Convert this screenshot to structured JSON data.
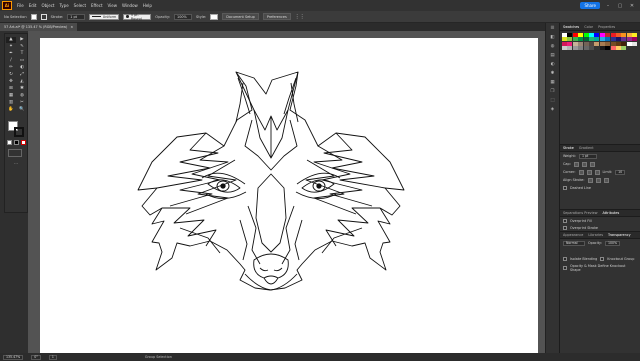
{
  "menubar": {
    "logo": "Ai",
    "items": [
      "File",
      "Edit",
      "Object",
      "Type",
      "Select",
      "Effect",
      "View",
      "Window",
      "Help"
    ],
    "share_label": "Share",
    "win_controls": [
      "–",
      "▢",
      "✕"
    ]
  },
  "controlbar": {
    "selection_label": "No Selection",
    "stroke_label": "Stroke:",
    "stroke_weight": "1 pt",
    "stroke_profile": "Uniform",
    "brush": "5 pt. Round",
    "opacity_label": "Opacity:",
    "opacity_value": "100%",
    "style_label": "Style:",
    "document_setup": "Document Setup",
    "preferences": "Preferences"
  },
  "document_tab": {
    "title": "57 Art.ai* @ 135.47 % (RGB/Preview)",
    "close": "×"
  },
  "tools": [
    "▲",
    "▶",
    "✦",
    "✎",
    "✒",
    "T",
    "/",
    "▭",
    "✏",
    "◐",
    "↻",
    "⤢",
    "✥",
    "◭",
    "⊞",
    "✱",
    "▦",
    "◍",
    "▥",
    "✂",
    "✋",
    "🔍"
  ],
  "toolbar_more": "···",
  "status": {
    "zoom": "135.47%",
    "angle": "0°",
    "artboard_num": "1",
    "tool_name": "Group Selection"
  },
  "side_icons": [
    "☰",
    "◧",
    "◍",
    "▤",
    "◐",
    "✱",
    "▦",
    "❐",
    "⬚",
    "◈"
  ],
  "swatches_panel": {
    "tabs": [
      "Swatches",
      "Color",
      "Properties"
    ],
    "colors": [
      "#ffffff",
      "#000000",
      "#ff0000",
      "#ffff00",
      "#00ff00",
      "#00ffff",
      "#0000ff",
      "#ff00ff",
      "#c1272d",
      "#ed1c24",
      "#f15a24",
      "#f7931e",
      "#fbb03b",
      "#fcee21",
      "#d9e021",
      "#8cc63f",
      "#39b54a",
      "#009245",
      "#006837",
      "#22b573",
      "#00a99d",
      "#29abe2",
      "#0071bc",
      "#2e3192",
      "#1b1464",
      "#662d91",
      "#93278f",
      "#9e005d",
      "#d4145a",
      "#ed1e79",
      "#c7b299",
      "#998675",
      "#736357",
      "#534741",
      "#c69c6d",
      "#a67c52",
      "#8c6239",
      "#754c24",
      "#603813",
      "#42210b",
      "#ffffff",
      "#e6e6e6",
      "#cccccc",
      "#b3b3b3",
      "#999999",
      "#808080",
      "#666666",
      "#4d4d4d",
      "#333333",
      "#1a1a1a",
      "#000000",
      "#ff6666",
      "#ffcc66",
      "#99cc66"
    ]
  },
  "stroke_panel": {
    "tabs": [
      "Stroke",
      "Gradient"
    ],
    "weight_label": "Weight:",
    "weight_value": "1 pt",
    "cap_label": "Cap:",
    "corner_label": "Corner:",
    "limit_label": "Limit:",
    "limit_value": "10",
    "align_label": "Align Stroke:",
    "dashed_label": "Dashed Line"
  },
  "attributes_panel": {
    "tabs": [
      "Separations Preview",
      "Attributes"
    ],
    "overprint_fill": "Overprint Fill",
    "overprint_stroke": "Overprint Stroke"
  },
  "transparency_panel": {
    "tabs": [
      "Appearance",
      "Libraries",
      "Transparency"
    ],
    "blend_mode": "Normal",
    "opacity_label": "Opacity:",
    "opacity_value": "100%",
    "isolate": "Isolate Blending",
    "knockout": "Knockout Group",
    "opacity_mask": "Opacity & Mask Define Knockout Shape"
  }
}
